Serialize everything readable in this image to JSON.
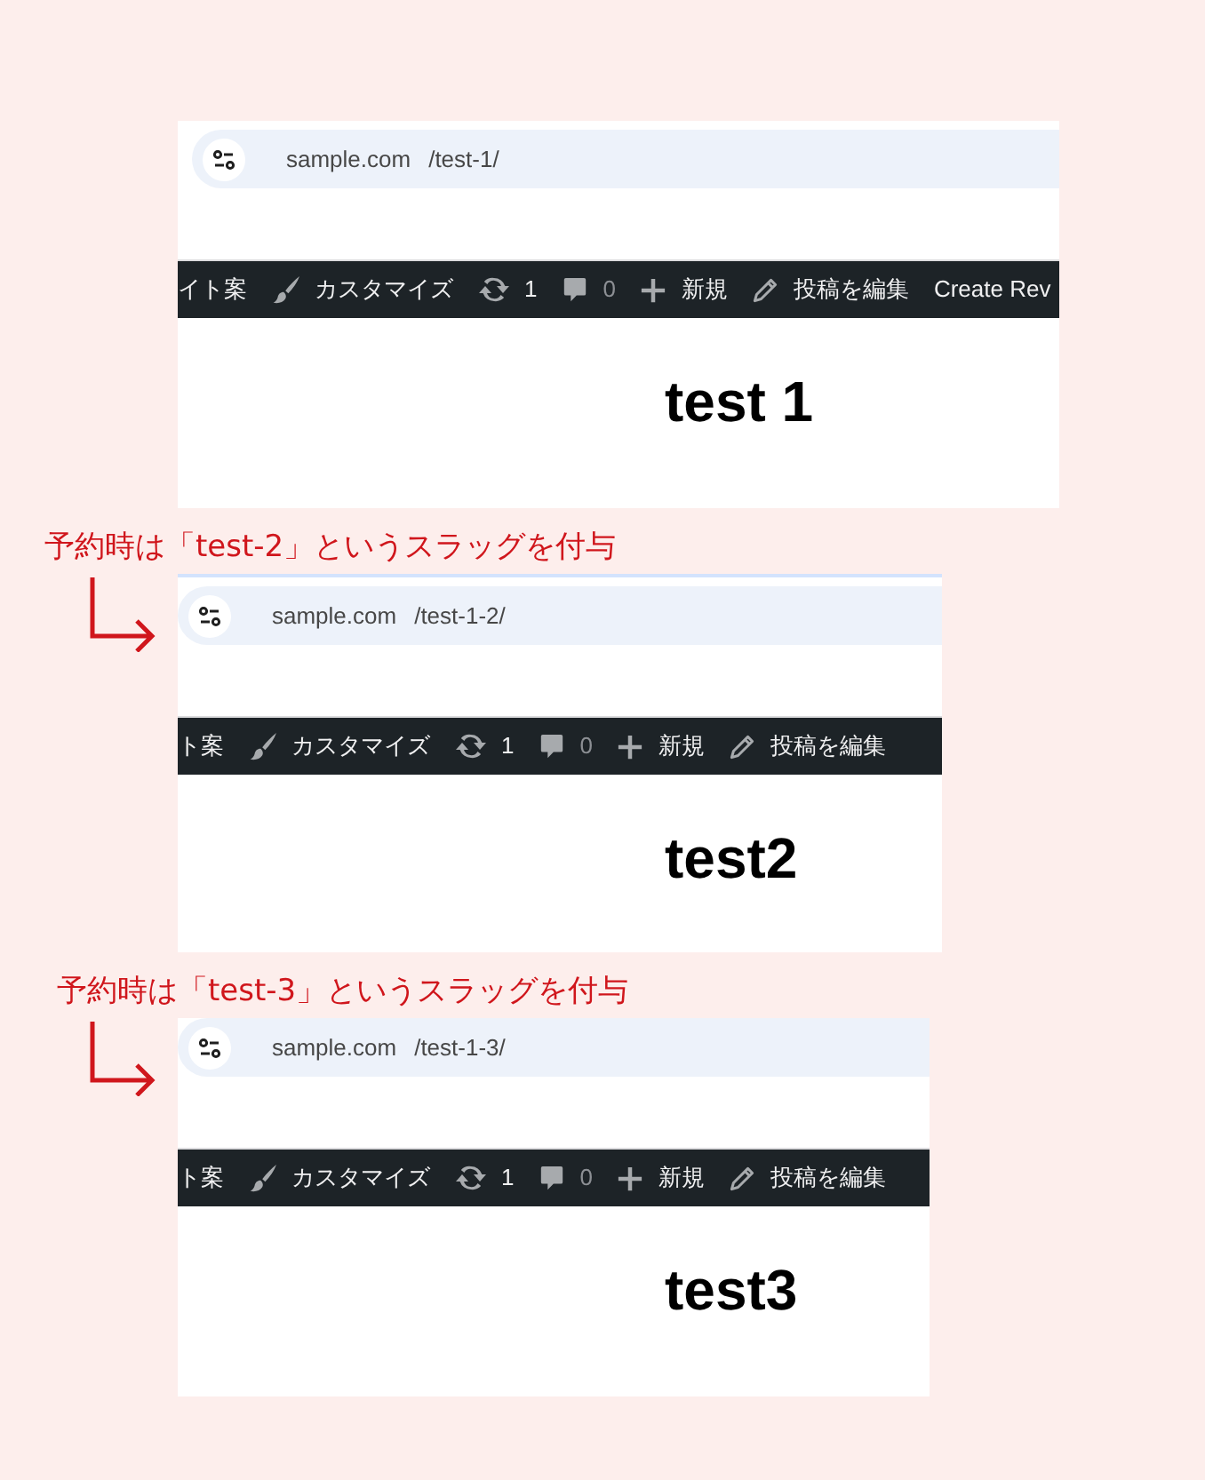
{
  "panels": [
    {
      "kind": "inset",
      "address_bar": {
        "domain": "sample.com",
        "path": "/test-1/"
      },
      "toolbar": [
        {
          "kind": "label",
          "text": "イト案"
        },
        {
          "kind": "brush",
          "text": "カスタマイズ"
        },
        {
          "kind": "updates",
          "text": "1"
        },
        {
          "kind": "comments",
          "text": "0"
        },
        {
          "kind": "new",
          "text": "新規"
        },
        {
          "kind": "edit",
          "text": "投稿を編集"
        },
        {
          "kind": "label",
          "text": "Create Rev"
        }
      ],
      "title": "test 1"
    },
    {
      "kind": "focused",
      "annotation": "予約時は「test-2」というスラッグを付与",
      "address_bar": {
        "domain": "sample.com",
        "path": "/test-1-2/"
      },
      "toolbar": [
        {
          "kind": "label",
          "text": "ト案"
        },
        {
          "kind": "brush",
          "text": "カスタマイズ"
        },
        {
          "kind": "updates",
          "text": "1"
        },
        {
          "kind": "comments",
          "text": "0"
        },
        {
          "kind": "new",
          "text": "新規"
        },
        {
          "kind": "edit",
          "text": "投稿を編集"
        }
      ],
      "title": "test2"
    },
    {
      "kind": "flush",
      "annotation": "予約時は「test-3」というスラッグを付与",
      "address_bar": {
        "domain": "sample.com",
        "path": "/test-1-3/"
      },
      "toolbar": [
        {
          "kind": "label",
          "text": "ト案"
        },
        {
          "kind": "brush",
          "text": "カスタマイズ"
        },
        {
          "kind": "updates",
          "text": "1"
        },
        {
          "kind": "comments",
          "text": "0"
        },
        {
          "kind": "new",
          "text": "新規"
        },
        {
          "kind": "edit",
          "text": "投稿を編集"
        }
      ],
      "title": "test3"
    }
  ]
}
